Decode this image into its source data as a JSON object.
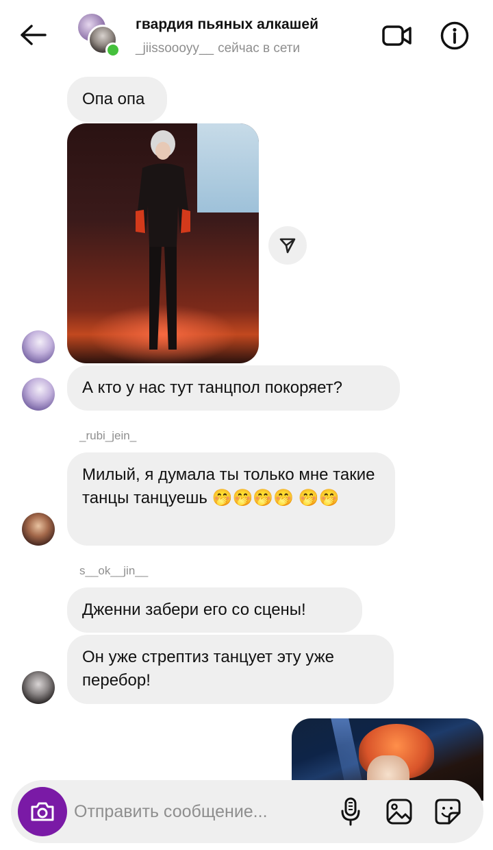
{
  "header": {
    "title": "гвардия пьяных алкашей",
    "username": "_jiissoooyy__",
    "status": "сейчас в сети"
  },
  "messages": [
    {
      "type": "text",
      "text": "Опа опа"
    },
    {
      "type": "image"
    },
    {
      "type": "text",
      "text": "А кто у нас тут танцпол покоряет?"
    },
    {
      "type": "text",
      "sender": "_rubi_jein_",
      "text": "Милый, я думала ты только мне такие танцы танцуешь 🤭🤭🤭🤭 🤭🤭"
    },
    {
      "type": "text",
      "sender": "s__ok__jin__",
      "text": "Дженни забери его со сцены!"
    },
    {
      "type": "text",
      "text": "Он уже стрептиз танцует эту уже перебор!"
    },
    {
      "type": "image",
      "outgoing": true
    }
  ],
  "composer": {
    "placeholder": "Отправить сообщение..."
  },
  "colors": {
    "bubble": "#efefef",
    "accent": "#7a1aa6",
    "online": "#45c03c",
    "muted": "#8e8e8e"
  },
  "icons": [
    "back-arrow-icon",
    "video-call-icon",
    "info-icon",
    "share-icon",
    "camera-icon",
    "microphone-icon",
    "gallery-icon",
    "sticker-icon"
  ]
}
